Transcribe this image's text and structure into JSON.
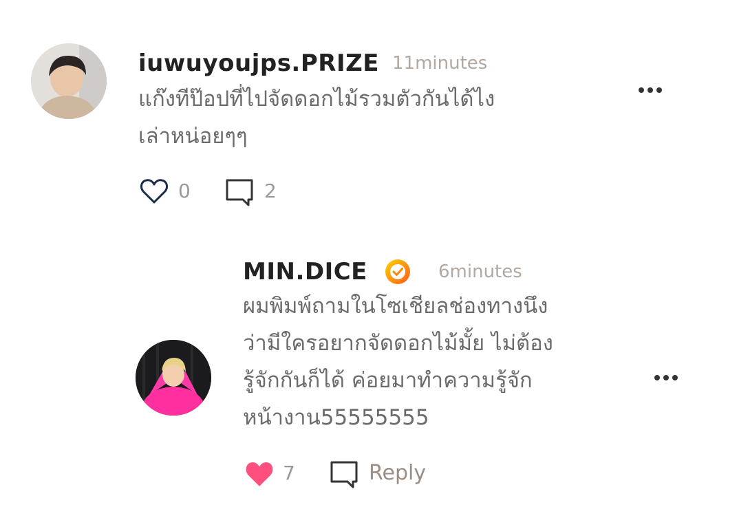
{
  "comments": [
    {
      "username": "iuwuyoujps.PRIZE",
      "time": "11minutes",
      "text_lines": [
        "แก๊งทีป๊อปที่ไปจัดดอกไม้รวมตัวกันได้ไง",
        "เล่าหน่อยๆๆ"
      ],
      "likes": "0",
      "replies": "2",
      "liked": false
    },
    {
      "username": "MIN.DICE",
      "verified": true,
      "time": "6minutes",
      "text_lines": [
        "ผมพิมพ์ถามในโซเชียลช่องทางนึง",
        "ว่ามีใครอยากจัดดอกไม้มั้ย ไม่ต้อง",
        "รู้จักกันก็ได้ ค่อยมาทำความรู้จัก",
        "หน้างาน55555555"
      ],
      "likes": "7",
      "reply_label": "Reply",
      "liked": true
    }
  ],
  "icons": {
    "like": "heart-icon",
    "comment": "speech-bubble-icon",
    "more": "more-options-icon",
    "verified": "verified-badge-icon"
  },
  "colors": {
    "liked_heart": "#ff4f7e",
    "unliked_heart_stroke": "#1c2a4a",
    "time": "#b3a8a0",
    "verified_badge": "#ffb000"
  }
}
